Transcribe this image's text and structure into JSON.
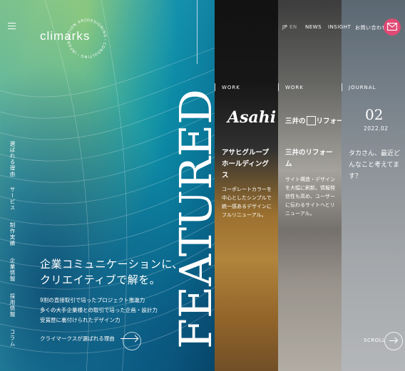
{
  "brand": {
    "logo": "climarks",
    "ring_text": "DESIGNING・CONSULTING・INFORMATION ARCHITECTURE・"
  },
  "sidebar": {
    "items": [
      {
        "label": "選ばれる理由"
      },
      {
        "label": "サービス"
      },
      {
        "label": "制作実績"
      },
      {
        "label": "企業情報"
      },
      {
        "label": "採用情報"
      },
      {
        "label": "コラム"
      }
    ]
  },
  "hero": {
    "featured": "FEATURED",
    "headline": [
      "企業コミュニケーションに、",
      "クリエイティブで解を。"
    ],
    "sub": [
      "9割の直接取引で培ったプロジェクト推進力",
      "多くの大手企業様との取引で培った企画・設計力",
      "受賞歴に裏付けられたデザイン力"
    ],
    "cta": "クライマークスが選ばれる理由"
  },
  "topnav": {
    "jp": "JP",
    "en": "EN",
    "news": "NEWS",
    "insight": "INSIGHT",
    "contact": "お問い合わせ"
  },
  "cards": [
    {
      "label": "WORK",
      "logo": "Asahi",
      "title": "アサヒグループホールディングス",
      "desc": "コーポレートカラーを中心としたシンプルで統一感あるデザインにフルリニューアル。"
    },
    {
      "label": "WORK",
      "logo_parts": [
        "三井の",
        "リフォーム"
      ],
      "title": "三井のリフォーム",
      "desc": "サイト構造・デザインを大幅に刷新。情報発信性も高め、ユーザーに伝わるサイトへとリニューアル。"
    },
    {
      "label": "JOURNAL",
      "number": "02",
      "date": "2022.02",
      "title": "タカさん、最近どんなこと考えてます？"
    }
  ],
  "scroll": {
    "label": "SCROLL"
  },
  "colors": {
    "accent": "#e04a74"
  },
  "icons": {
    "menu": "hamburger-icon",
    "mail": "mail-icon",
    "arrow": "arrow-right-icon"
  }
}
